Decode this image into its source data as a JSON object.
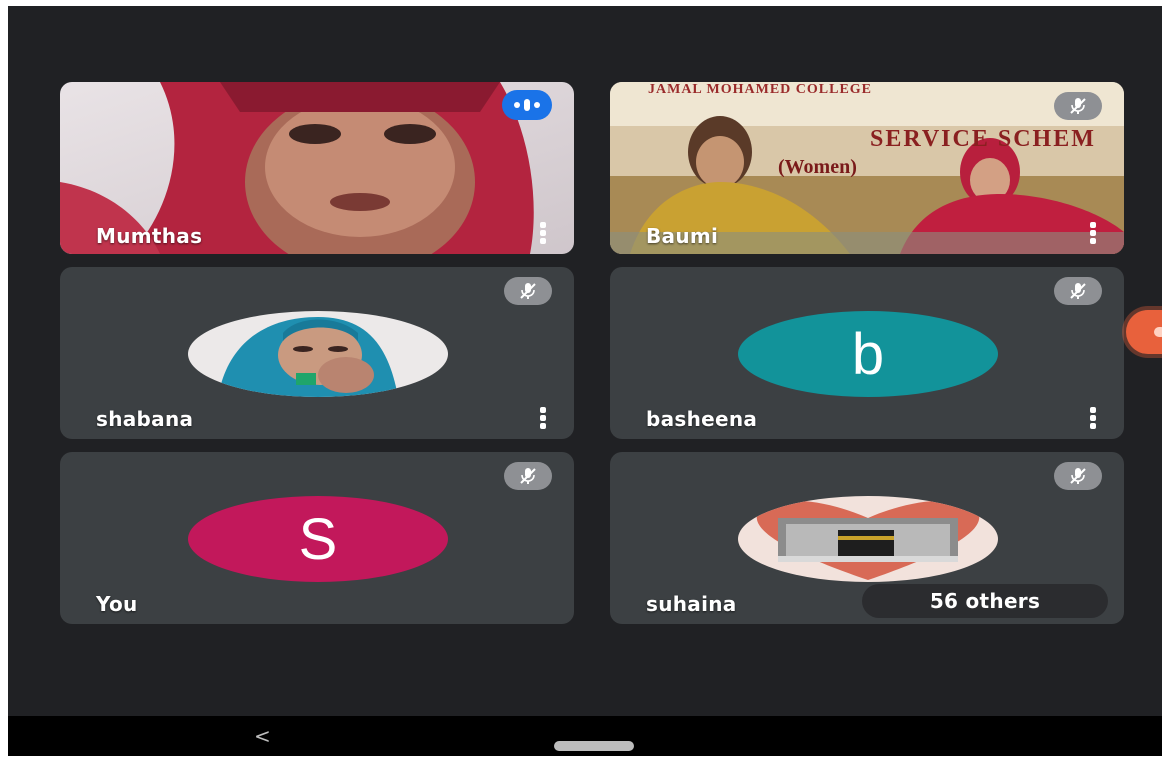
{
  "participants": {
    "mumthas": {
      "name": "Mumthas",
      "status": "speaking"
    },
    "baumi": {
      "name": "Baumi",
      "status": "muted",
      "banner_line1": "JAMAL MOHAMED COLLEGE",
      "banner_line2": "SERVICE SCHEM",
      "banner_line3": "(Women)"
    },
    "shabana": {
      "name": "shabana",
      "status": "muted"
    },
    "basheena": {
      "name": "basheena",
      "status": "muted",
      "avatar_letter": "b"
    },
    "you": {
      "name": "You",
      "status": "muted",
      "avatar_letter": "S"
    },
    "suhaina": {
      "name": "suhaina",
      "status": "muted"
    }
  },
  "others_label": "56 others",
  "navigation": {
    "back_glyph": "<"
  },
  "icons": {
    "mute": "mic-off-icon",
    "speaking": "audio-level-icon",
    "more": "more-vert-icon",
    "back": "back-icon",
    "home": "home-pill-icon"
  },
  "colors": {
    "background": "#202124",
    "tile": "#3c4043",
    "speaking_badge": "#1a73e8",
    "basheena_avatar": "#12939a",
    "you_avatar": "#c2185b"
  }
}
